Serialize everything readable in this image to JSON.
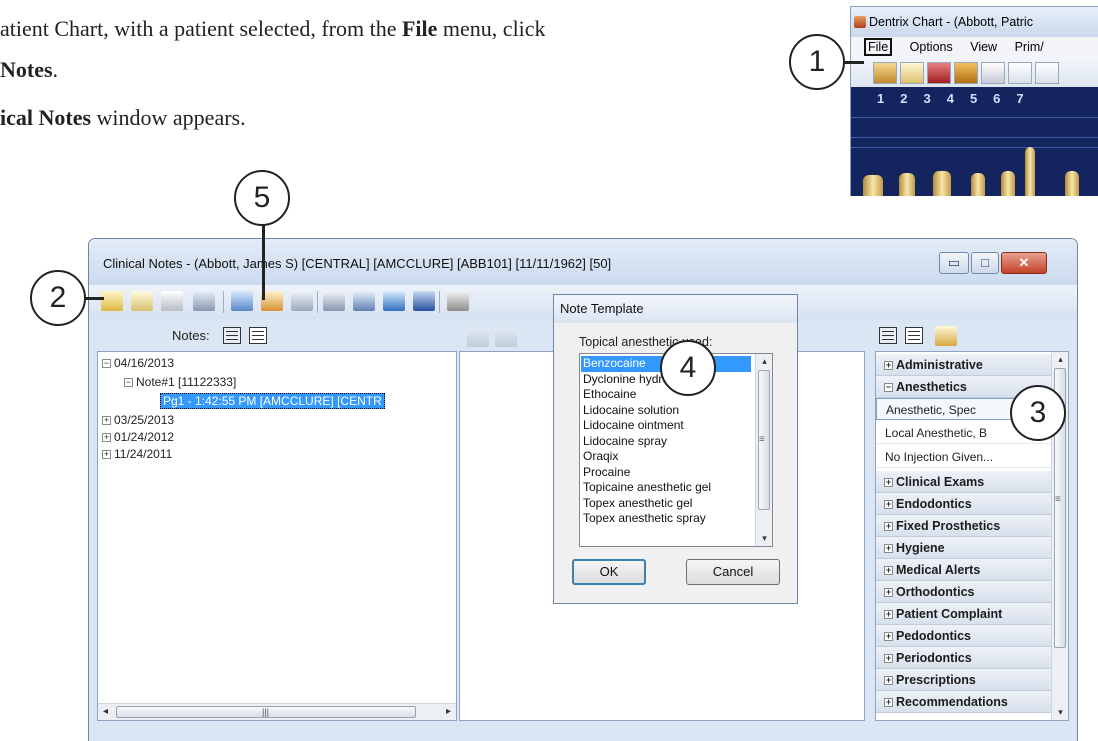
{
  "instructions": {
    "line1_prefix": "atient Chart, with a patient selected, from the ",
    "line1_file": "File",
    "line1_suffix": " menu, click",
    "line2_notes": "Notes",
    "line2_period": ".",
    "line3_bold": "ical Notes",
    "line3_rest": " window appears."
  },
  "callouts": [
    "1",
    "2",
    "3",
    "4",
    "5"
  ],
  "dentrix_chart": {
    "title": "Dentrix Chart - (Abbott, Patric",
    "menu": [
      "File",
      "Options",
      "View",
      "Prim/"
    ],
    "tooth_numbers": [
      "1",
      "2",
      "3",
      "4",
      "5",
      "6",
      "7"
    ]
  },
  "clinical_notes": {
    "title": "Clinical Notes - (Abbott, James S) [CENTRAL] [AMCCLURE] [ABB101] [11/11/1962] [50]",
    "window_buttons": {
      "minimize": "▭",
      "maximize": "□",
      "close": "✕"
    },
    "notes_label": "Notes:",
    "tree": {
      "date1": "04/16/2013",
      "note": "Note#1 [11122333]",
      "page": "Pg1 - 1:42:55 PM [AMCCLURE] [CENTR",
      "date2": "03/25/2013",
      "date3": "01/24/2012",
      "date4": "11/24/2011"
    },
    "categories": {
      "administrative": "Administrative",
      "anesthetics": "Anesthetics",
      "sub1": "Anesthetic, Spec",
      "sub2": "Local Anesthetic, B",
      "sub3": "No Injection Given...",
      "clinical_exams": "Clinical Exams",
      "endodontics": "Endodontics",
      "fixed_prosthetics": "Fixed Prosthetics",
      "hygiene": "Hygiene",
      "medical_alerts": "Medical Alerts",
      "orthodontics": "Orthodontics",
      "patient_complaint": "Patient Complaint",
      "pedodontics": "Pedodontics",
      "periodontics": "Periodontics",
      "prescriptions": "Prescriptions",
      "recommendations": "Recommendations"
    }
  },
  "note_template": {
    "title": "Note Template",
    "label": "Topical anesthetic used:",
    "options": {
      "o1": "Benzocaine",
      "o2": "Dyclonine hydrochloride",
      "o3": "Ethocaine",
      "o4": "Lidocaine solution",
      "o5": "Lidocaine ointment",
      "o6": "Lidocaine spray",
      "o7": "Oraqix",
      "o8": "Procaine",
      "o9": "Topicaine anesthetic gel",
      "o10": "Topex anesthetic gel",
      "o11": "Topex anesthetic spray"
    },
    "ok_label": "OK",
    "cancel_label": "Cancel"
  },
  "colors": {
    "selection": "#3399ff",
    "window_frame": "#dbe6f4",
    "close_button": "#c4412a",
    "chart_background": "#14245e"
  }
}
